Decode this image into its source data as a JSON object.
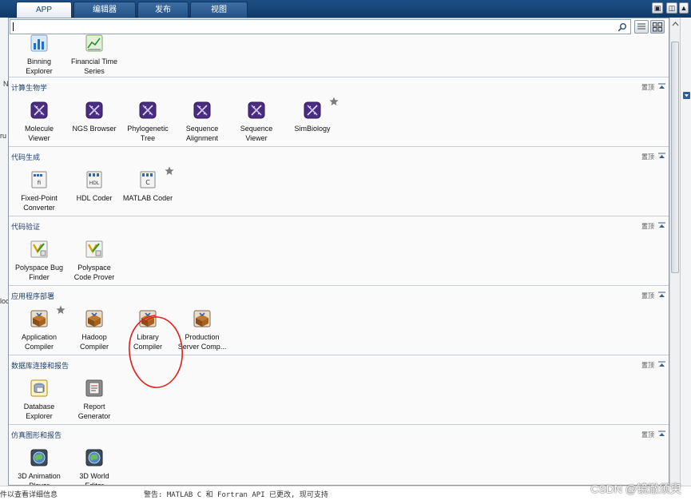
{
  "tabs": [
    {
      "label": "APP",
      "active": true
    },
    {
      "label": "编辑器",
      "active": false
    },
    {
      "label": "发布",
      "active": false
    },
    {
      "label": "视图",
      "active": false
    }
  ],
  "background": {
    "left_fragments": [
      "N",
      "ru",
      "loc"
    ],
    "bottom_left": "件以查看详细信息",
    "bottom_text": "警告: MATLAB C 和 Fortran API 已更改, 现可支持"
  },
  "search": {
    "value": ""
  },
  "sections": [
    {
      "title": "",
      "collapse_label": "",
      "apps": [
        {
          "label": [
            "Binning",
            "Explorer"
          ],
          "icon": "bar-chart-icon",
          "fav": false
        },
        {
          "label": [
            "Financial Time",
            "Series"
          ],
          "icon": "line-chart-icon",
          "fav": false
        }
      ]
    },
    {
      "title": "计算生物学",
      "collapse_label": "置顶",
      "apps": [
        {
          "label": [
            "Molecule",
            "Viewer"
          ],
          "icon": "dna-icon",
          "fav": false
        },
        {
          "label": [
            "NGS Browser"
          ],
          "icon": "dna-icon",
          "fav": false
        },
        {
          "label": [
            "Phylogenetic",
            "Tree"
          ],
          "icon": "dna-icon",
          "fav": false
        },
        {
          "label": [
            "Sequence",
            "Alignment"
          ],
          "icon": "dna-icon",
          "fav": false
        },
        {
          "label": [
            "Sequence",
            "Viewer"
          ],
          "icon": "dna-icon",
          "fav": false
        },
        {
          "label": [
            "SimBiology"
          ],
          "icon": "dna-icon",
          "fav": true
        }
      ]
    },
    {
      "title": "代码生成",
      "collapse_label": "置顶",
      "apps": [
        {
          "label": [
            "Fixed-Point",
            "Converter"
          ],
          "icon": "fixed-point-icon",
          "fav": false
        },
        {
          "label": [
            "HDL Coder"
          ],
          "icon": "hdl-coder-icon",
          "fav": false
        },
        {
          "label": [
            "MATLAB Coder"
          ],
          "icon": "matlab-coder-icon",
          "fav": true
        }
      ]
    },
    {
      "title": "代码验证",
      "collapse_label": "置顶",
      "apps": [
        {
          "label": [
            "Polyspace Bug",
            "Finder"
          ],
          "icon": "polyspace-icon",
          "fav": false
        },
        {
          "label": [
            "Polyspace",
            "Code Prover"
          ],
          "icon": "polyspace-icon",
          "fav": false
        }
      ]
    },
    {
      "title": "应用程序部署",
      "collapse_label": "置顶",
      "apps": [
        {
          "label": [
            "Application",
            "Compiler"
          ],
          "icon": "compiler-box-icon",
          "fav": true
        },
        {
          "label": [
            "Hadoop",
            "Compiler"
          ],
          "icon": "compiler-box-icon",
          "fav": false
        },
        {
          "label": [
            "Library",
            "Compiler"
          ],
          "icon": "compiler-box-icon",
          "fav": false
        },
        {
          "label": [
            "Production",
            "Server Comp..."
          ],
          "icon": "compiler-box-icon",
          "fav": false
        }
      ]
    },
    {
      "title": "数据库连接和报告",
      "collapse_label": "置顶",
      "apps": [
        {
          "label": [
            "Database",
            "Explorer"
          ],
          "icon": "database-icon",
          "fav": false
        },
        {
          "label": [
            "Report",
            "Generator"
          ],
          "icon": "report-icon",
          "fav": false
        }
      ]
    },
    {
      "title": "仿真图形和报告",
      "collapse_label": "置顶",
      "apps": [
        {
          "label": [
            "3D Animation",
            "Player"
          ],
          "icon": "globe-icon",
          "fav": false
        },
        {
          "label": [
            "3D World",
            "Editor"
          ],
          "icon": "globe-icon",
          "fav": false
        }
      ]
    }
  ],
  "watermark": "CSDN @镜澈须臾",
  "colors": {
    "tab_bar": "#0f3a68",
    "section_title": "#1f3f6a",
    "annotation": "#e0201d"
  }
}
